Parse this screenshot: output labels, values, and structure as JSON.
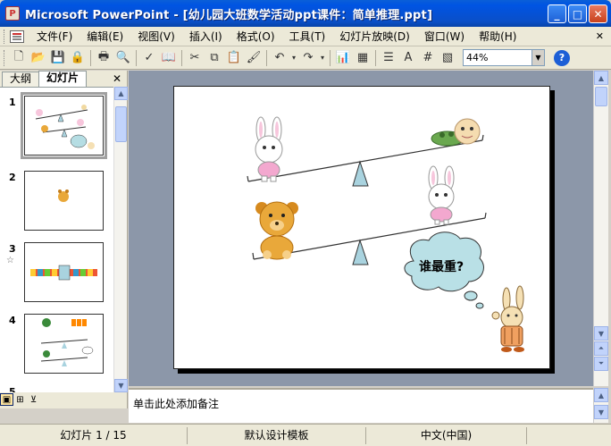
{
  "window": {
    "title": "Microsoft PowerPoint - [幼儿园大班数学活动ppt课件：简单推理.ppt]",
    "minimize": "_",
    "maximize": "□",
    "close": "✕"
  },
  "menu": {
    "items": [
      "文件(F)",
      "编辑(E)",
      "视图(V)",
      "插入(I)",
      "格式(O)",
      "工具(T)",
      "幻灯片放映(D)",
      "窗口(W)",
      "帮助(H)"
    ],
    "doc_close": "✕"
  },
  "toolbar": {
    "zoom": "44%",
    "help": "?"
  },
  "left_pane": {
    "tabs": [
      "大纲",
      "幻灯片"
    ],
    "close": "✕",
    "thumbnails": [
      {
        "number": "1",
        "selected": true
      },
      {
        "number": "2",
        "selected": false
      },
      {
        "number": "3",
        "selected": false,
        "has_animation": true
      },
      {
        "number": "4",
        "selected": false
      },
      {
        "number": "5",
        "selected": false
      }
    ]
  },
  "slide": {
    "bubble_text": "谁最重?"
  },
  "notes": {
    "placeholder": "单击此处添加备注"
  },
  "status": {
    "slide_position": "幻灯片 1 / 15",
    "template": "默认设计模板",
    "language": "中文(中国)"
  }
}
